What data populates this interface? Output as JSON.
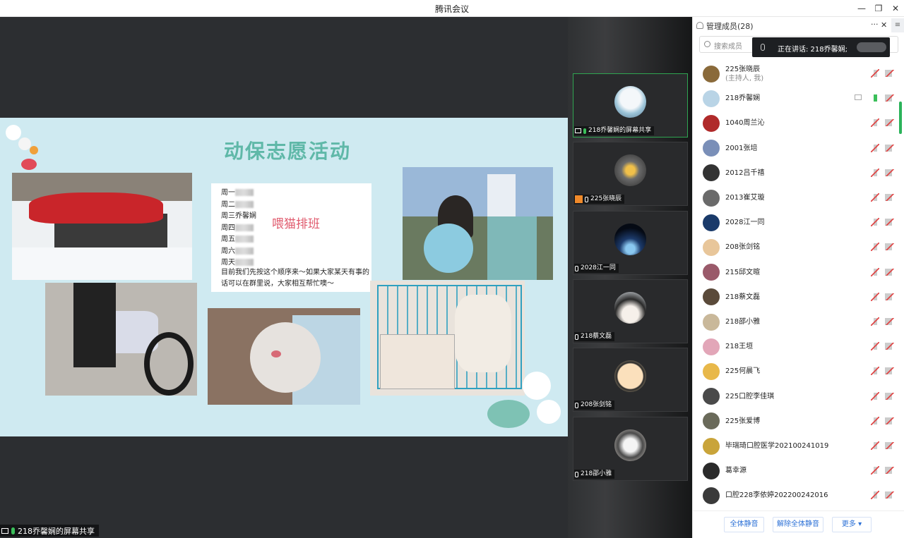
{
  "window": {
    "title": "腾讯会议",
    "minimize": "—",
    "restore": "❐",
    "close": "✕"
  },
  "share": {
    "slide_title": "动保志愿活动",
    "schedule": [
      "周一",
      "周二",
      "周三乔馨娴",
      "周四",
      "周五",
      "周六",
      "周天"
    ],
    "note": "喂猫排班",
    "desc": "目前我们先按这个顺序来～如果大家某天有事的话可以在群里说，大家相互帮忙噢～",
    "presenter_label": "218乔馨娴的屏幕共享"
  },
  "gallery": [
    {
      "label": "218乔馨娴的屏幕共享",
      "active": true
    },
    {
      "label": "225张晓辰",
      "active": false
    },
    {
      "label": "2028江一同",
      "active": false
    },
    {
      "label": "218蔡文磊",
      "active": false
    },
    {
      "label": "208张剑铭",
      "active": false
    },
    {
      "label": "218邵小雅",
      "active": false
    }
  ],
  "panel": {
    "title": "管理成员(28)",
    "more": "···",
    "close": "✕",
    "search_placeholder": "搜索成员",
    "speaking": "正在讲话: 218乔馨娴;",
    "members": [
      {
        "name": "225张晓辰",
        "sub": "(主持人, 我)",
        "color": "#8a6a3a"
      },
      {
        "name": "218乔馨娴",
        "sub": "",
        "color": "#b9d4e6"
      },
      {
        "name": "1040周兰沁",
        "sub": "",
        "color": "#b02a2a"
      },
      {
        "name": "2001张培",
        "sub": "",
        "color": "#7a8fb8"
      },
      {
        "name": "2012吕千禧",
        "sub": "",
        "color": "#333333"
      },
      {
        "name": "2013崔艾璇",
        "sub": "",
        "color": "#6a6a6a"
      },
      {
        "name": "2028江一同",
        "sub": "",
        "color": "#1a3a6a"
      },
      {
        "name": "208张剑铭",
        "sub": "",
        "color": "#e8c69a"
      },
      {
        "name": "215邱文暄",
        "sub": "",
        "color": "#9a5a6a"
      },
      {
        "name": "218蔡文磊",
        "sub": "",
        "color": "#5a4a3a"
      },
      {
        "name": "218邵小雅",
        "sub": "",
        "color": "#c9b89a"
      },
      {
        "name": "218王垣",
        "sub": "",
        "color": "#e2a6b8"
      },
      {
        "name": "225何晨飞",
        "sub": "",
        "color": "#e8b84a"
      },
      {
        "name": "225口腔李佳琪",
        "sub": "",
        "color": "#4a4a4a"
      },
      {
        "name": "225张爱博",
        "sub": "",
        "color": "#6a6a5a"
      },
      {
        "name": "毕瑞琦口腔医学202100241019",
        "sub": "",
        "color": "#c9a43a"
      },
      {
        "name": "葛幸源",
        "sub": "",
        "color": "#2a2a2a"
      },
      {
        "name": "口腔228李依婷202200242016",
        "sub": "",
        "color": "#3a3a3a"
      }
    ],
    "footer": {
      "mute_all": "全体静音",
      "unmute_all": "解除全体静音",
      "more": "更多 ▾"
    }
  }
}
